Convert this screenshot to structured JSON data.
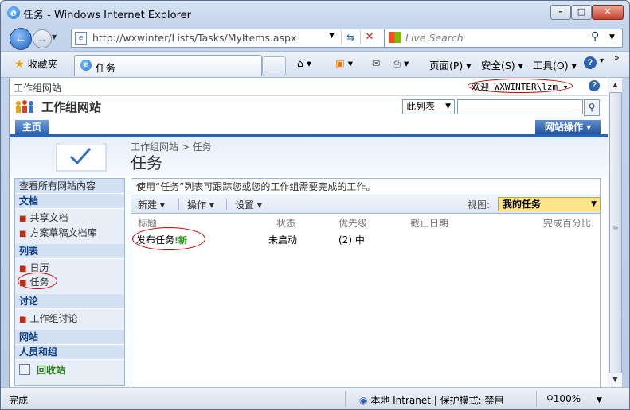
{
  "window": {
    "title": "任务 - Windows Internet Explorer",
    "minimize": "–",
    "maximize": "□",
    "close": "✕"
  },
  "address": {
    "url": "http://wxwinter/Lists/Tasks/MyItems.aspx",
    "search_placeholder": "Live Search"
  },
  "favbar": {
    "favorites": "收藏夹",
    "tab_title": "任务",
    "tools": [
      "页面(P)",
      "安全(S)",
      "工具(O)"
    ]
  },
  "sp": {
    "site_small": "工作组网站",
    "welcome": "欢迎 WXWINTER\\lzm",
    "site_title": "工作组网站",
    "scope": "此列表",
    "home_tab": "主页",
    "site_actions": "网站操作",
    "breadcrumb": "工作组网站 > 任务",
    "page_title": "任务"
  },
  "leftnav": {
    "view_all": "查看所有网站内容",
    "documents": "文档",
    "doc_items": [
      "共享文档",
      "方案草稿文档库"
    ],
    "lists": "列表",
    "list_items": [
      "日历",
      "任务"
    ],
    "discussions": "讨论",
    "discussion_items": [
      "工作组讨论"
    ],
    "sites": "网站",
    "people": "人员和组",
    "recycle": "回收站"
  },
  "list": {
    "description": "使用“任务”列表可跟踪您或您的工作组需要完成的工作。",
    "toolbar": {
      "new": "新建",
      "actions": "操作",
      "settings": "设置",
      "view_label": "视图:",
      "view_value": "我的任务"
    },
    "columns": [
      "标题",
      "状态",
      "优先级",
      "截止日期",
      "完成百分比"
    ],
    "rows": [
      {
        "title": "发布任务",
        "new_badge": "!新",
        "status": "未启动",
        "priority": "(2) 中",
        "due": "",
        "percent": ""
      }
    ]
  },
  "status": {
    "text": "完成",
    "zone": "本地 Intranet | 保护模式: 禁用",
    "zoom": "100%"
  },
  "colors": {
    "accent": "#2b62b1",
    "annotation": "#cc0000",
    "view_highlight": "#fde48a"
  }
}
